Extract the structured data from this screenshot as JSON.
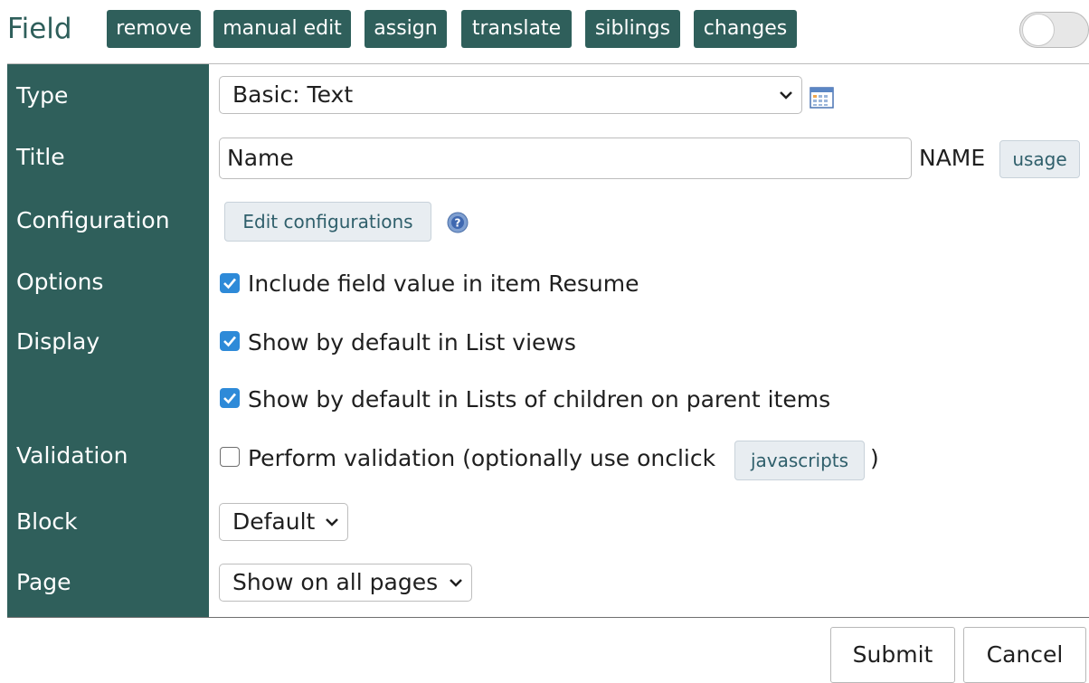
{
  "header": {
    "title": "Field",
    "buttons": [
      "remove",
      "manual edit",
      "assign",
      "translate",
      "siblings",
      "changes"
    ]
  },
  "labels": {
    "type": "Type",
    "title": "Title",
    "configuration": "Configuration",
    "options": "Options",
    "display": "Display",
    "validation": "Validation",
    "block": "Block",
    "page": "Page"
  },
  "form": {
    "type_value": "Basic: Text",
    "title_value": "Name",
    "title_code": "NAME",
    "usage_label": "usage",
    "edit_config_label": "Edit configurations",
    "option_resume": "Include field value in item Resume",
    "display_list": "Show by default in List views",
    "display_children": "Show by default in Lists of children on parent items",
    "validation_text": "Perform validation (optionally use onclick",
    "javascripts_label": "javascripts",
    "validation_close": ")",
    "block_value": "Default",
    "page_value": "Show on all pages"
  },
  "footer": {
    "submit": "Submit",
    "cancel": "Cancel"
  },
  "colors": {
    "accent": "#2f5f5b",
    "checkbox": "#2e8ad8"
  }
}
